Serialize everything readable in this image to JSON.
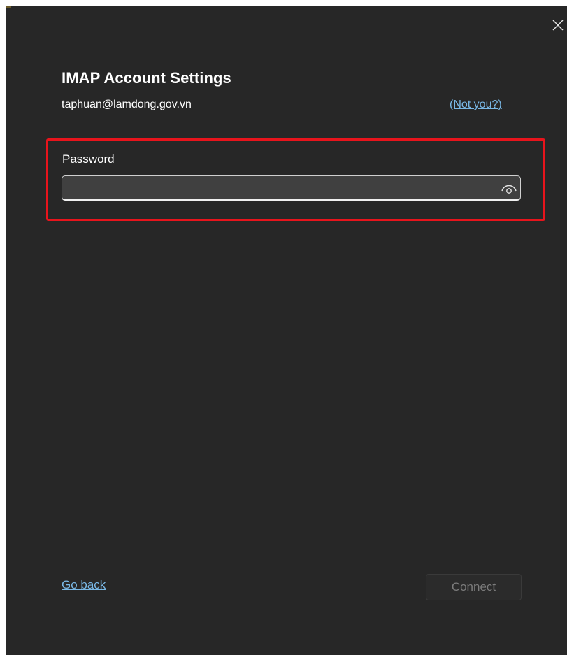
{
  "dialog": {
    "title": "IMAP Account Settings",
    "email": "taphuan@lamdong.gov.vn",
    "not_you_link": "(Not you?)",
    "close_icon": "close-icon"
  },
  "password": {
    "label": "Password",
    "value": "",
    "placeholder": "",
    "reveal_icon": "eye-icon"
  },
  "footer": {
    "go_back_link": "Go back",
    "connect_label": "Connect",
    "connect_enabled": false
  },
  "colors": {
    "background": "#272727",
    "link": "#79b8e6",
    "highlight": "#e8141c",
    "disabled_text": "#7c7c7c"
  }
}
